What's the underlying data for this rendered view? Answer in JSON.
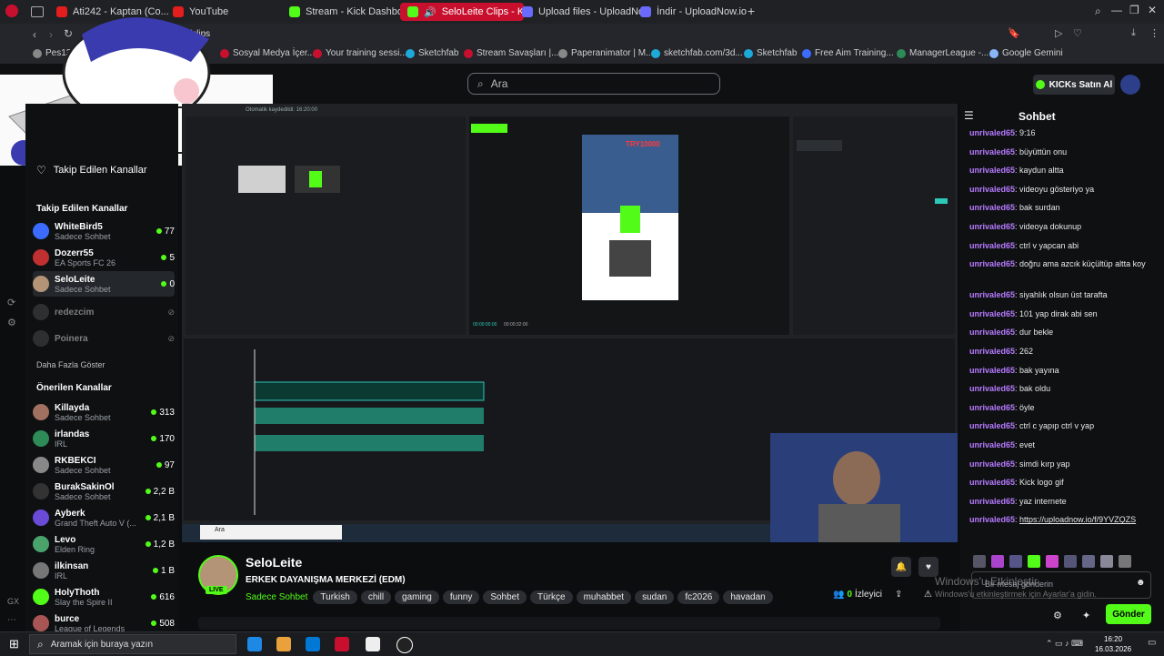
{
  "browser": {
    "tabs": [
      {
        "label": "Ati242 - Kaptan (Co...",
        "active": false
      },
      {
        "label": "YouTube",
        "active": false
      },
      {
        "label": "Stream - Kick Dashboard",
        "active": false
      },
      {
        "label": "SeloLeite Clips - K",
        "active": true
      },
      {
        "label": "Upload files - UploadNow",
        "active": false
      },
      {
        "label": "İndir - UploadNow.io",
        "active": false
      }
    ],
    "address": "kick.com/seloleite/clips",
    "bookmarks": [
      "Pes13-22",
      "Sosyal Medya İçer...",
      "Your training sessi...",
      "Sketchfab",
      "Stream Savaşları |...",
      "Paperanimator | M...",
      "sketchfab.com/3d...",
      "Sketchfab",
      "Free Aim Training...",
      "ManagerLeague -...",
      "Google Gemini"
    ]
  },
  "header": {
    "search_placeholder": "Ara",
    "kicks_button": "KICKs Satın Al"
  },
  "sidebar": {
    "followed_top": "Takip Edilen Kanallar",
    "followed_heading": "Takip Edilen Kanallar",
    "followed": [
      {
        "name": "WhiteBird5",
        "sub": "Sadece Sohbet",
        "count": "77",
        "live": true
      },
      {
        "name": "Dozerr55",
        "sub": "EA Sports FC 26",
        "count": "5",
        "live": true
      },
      {
        "name": "SeloLeite",
        "sub": "Sadece Sohbet",
        "count": "0",
        "live": true
      },
      {
        "name": "redezcim",
        "sub": "",
        "count": "",
        "live": false
      },
      {
        "name": "Poinera",
        "sub": "",
        "count": "",
        "live": false
      }
    ],
    "show_more": "Daha Fazla Göster",
    "recommended_heading": "Önerilen Kanallar",
    "recommended": [
      {
        "name": "Killayda",
        "sub": "Sadece Sohbet",
        "count": "313"
      },
      {
        "name": "irlandas",
        "sub": "IRL",
        "count": "170"
      },
      {
        "name": "RKBEKCI",
        "sub": "Sadece Sohbet",
        "count": "97"
      },
      {
        "name": "BurakSakinOl",
        "sub": "Sadece Sohbet",
        "count": "2,2 B"
      },
      {
        "name": "Ayberk",
        "sub": "Grand Theft Auto V (...",
        "count": "2,1 B"
      },
      {
        "name": "Levo",
        "sub": "Elden Ring",
        "count": "1,2 B"
      },
      {
        "name": "ilkinsan",
        "sub": "IRL",
        "count": "1 B"
      },
      {
        "name": "HolyThoth",
        "sub": "Slay the Spire II",
        "count": "616"
      },
      {
        "name": "burce",
        "sub": "League of Legends",
        "count": "508"
      }
    ]
  },
  "stream_overlay": {
    "clip_title": "Otomatik kaydedildi: 16:20:00",
    "timecode": "00:00:00:00",
    "duration": "00:00:32:00",
    "cam_label": "TRY10000",
    "taskbar_search": "Ara"
  },
  "channel": {
    "name": "SeloLeite",
    "title": "ERKEK DAYANIŞMA MERKEZİ (EDM)",
    "category": "Sadece Sohbet",
    "tags": [
      "Turkish",
      "chill",
      "gaming",
      "funny",
      "Sohbet",
      "Türkçe",
      "muhabbet",
      "sudan",
      "fc2026",
      "havadan"
    ],
    "live_badge": "LIVE",
    "viewers": "0",
    "viewers_label": "İzleyici"
  },
  "chat": {
    "title": "Sohbet",
    "messages": [
      {
        "user": "unrivaled65",
        "text": "9:16"
      },
      {
        "user": "unrivaled65",
        "text": "büyüttün onu"
      },
      {
        "user": "unrivaled65",
        "text": "kaydun altta"
      },
      {
        "user": "unrivaled65",
        "text": "videoyu gösteriyo ya"
      },
      {
        "user": "unrivaled65",
        "text": "bak surdan"
      },
      {
        "user": "unrivaled65",
        "text": "videoya dokunup"
      },
      {
        "user": "unrivaled65",
        "text": "ctrl v yapcan abi"
      },
      {
        "user": "unrivaled65",
        "text": "doğru ama azcık küçültüp altta koy"
      },
      {
        "user": "unrivaled65",
        "text": "siyahlık olsun üst tarafta"
      },
      {
        "user": "unrivaled65",
        "text": "101 yap dirak abi sen"
      },
      {
        "user": "unrivaled65",
        "text": "dur bekle"
      },
      {
        "user": "unrivaled65",
        "text": "262"
      },
      {
        "user": "unrivaled65",
        "text": "bak yayına"
      },
      {
        "user": "unrivaled65",
        "text": "bak oldu"
      },
      {
        "user": "unrivaled65",
        "text": "öyle"
      },
      {
        "user": "unrivaled65",
        "text": "ctrl c yapıp ctrl v yap"
      },
      {
        "user": "unrivaled65",
        "text": "evet"
      },
      {
        "user": "unrivaled65",
        "text": "simdi kırp yap"
      },
      {
        "user": "unrivaled65",
        "text": "Kick logo gif"
      },
      {
        "user": "unrivaled65",
        "text": "yaz internete"
      },
      {
        "user": "unrivaled65",
        "text": "https://uploadnow.io/f/9YVZQZS"
      }
    ],
    "input_placeholder": "Bir mesaj gönderin",
    "send_button": "Gönder",
    "windows_activation_1": "Windows'u Etkinleştir",
    "windows_activation_2": "Windows'u etkinleştirmek için Ayarlar'a gidin."
  },
  "taskbar": {
    "search_placeholder": "Aramak için buraya yazın",
    "time": "16:20",
    "date": "16.03.2026"
  },
  "colors": {
    "kick_green": "#53fc18",
    "chat_user": "#b77bff",
    "active_tab": "#c8102e"
  }
}
